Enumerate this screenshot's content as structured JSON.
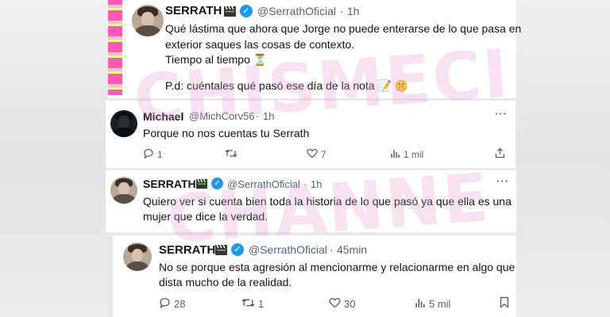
{
  "tweets": [
    {
      "name": "SERRATH",
      "handle": "@SerrathOficial",
      "time": "1h",
      "lines": [
        "Qué lástima que ahora que Jorge no puede enterarse de lo que pasa en",
        "exterior saques las cosas de contexto.",
        "Tiempo al tiempo ⏳",
        "",
        "P.d: cuéntales qué pasó ese día de la nota 📝 🤫"
      ]
    },
    {
      "name": "Michael",
      "handle": "@MichCorv56",
      "time": "1h",
      "lines": [
        "Porque no nos cuentas tu Serrath"
      ],
      "stats": {
        "replies": "1",
        "retweets": "",
        "likes": "7",
        "views": "1 mil"
      }
    },
    {
      "name": "SERRATH",
      "handle": "@SerrathOficial",
      "time": "1h",
      "lines": [
        "Quiero ver si cuenta bien toda la historia de lo que pasó ya que ella es una",
        "mujer que dice la verdad."
      ]
    },
    {
      "name": "SERRATH",
      "handle": "@SerrathOficial",
      "time": "45min",
      "lines": [
        "No se porque esta agresión al mencionarme y relacionarme en algo que",
        "dista mucho de la realidad."
      ],
      "stats": {
        "replies": "28",
        "retweets": "1",
        "likes": "30",
        "views": "5 mil"
      }
    }
  ],
  "separator": "·",
  "more_glyph": "···",
  "icons": [
    "clapper-icon",
    "verified-icon",
    "reply-icon",
    "retweet-icon",
    "like-icon",
    "views-icon",
    "bookmark-icon"
  ],
  "colors": {
    "verified": "#1d9bf0",
    "secondary": "#536471",
    "watermark": "#e696cd"
  }
}
